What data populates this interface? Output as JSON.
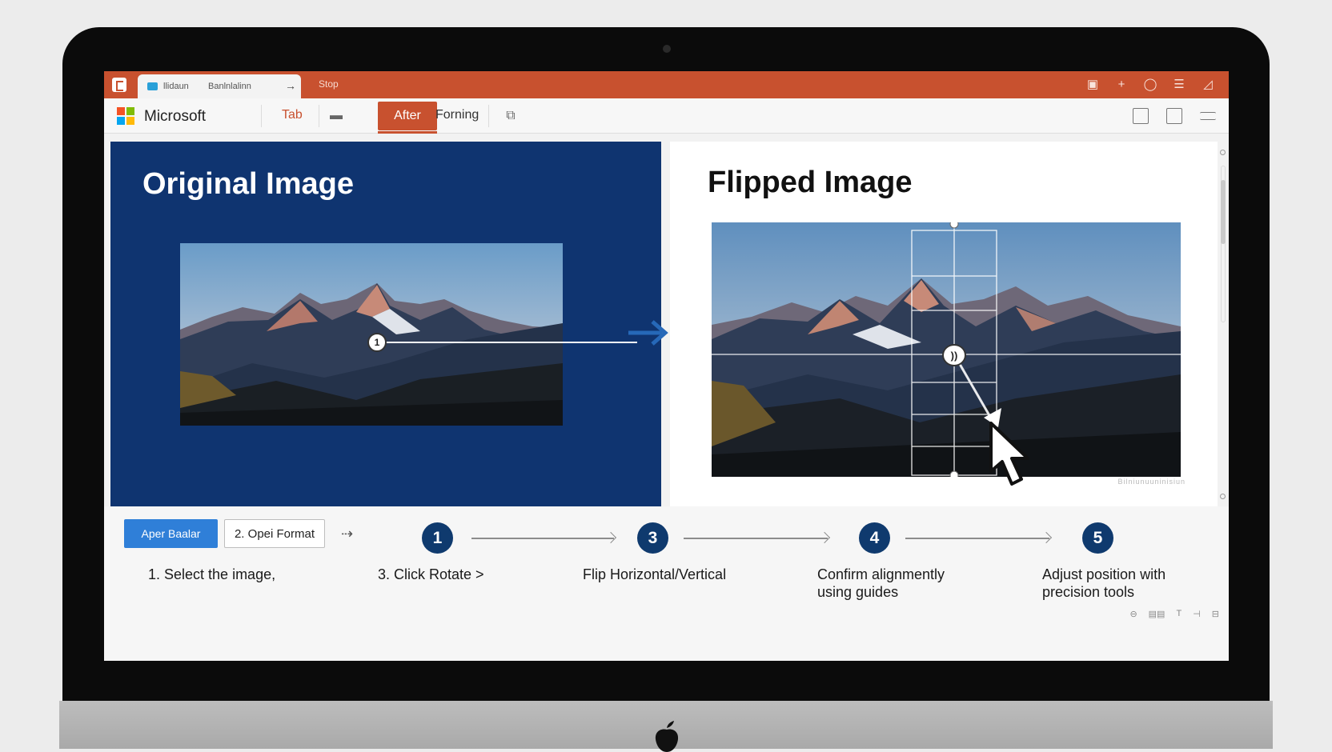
{
  "window": {
    "tab_text_1": "llidaun",
    "tab_text_2": "Banlnlalinn",
    "tab_arrow": "→",
    "title_text": "Stop"
  },
  "ribbon": {
    "brand": "Microsoft",
    "tabs": [
      {
        "label": "Tab"
      },
      {
        "label": "After"
      },
      {
        "label": "Forning"
      }
    ]
  },
  "panels": {
    "left_title": "Original Image",
    "right_title": "Flipped Image",
    "left_marker": "1",
    "right_marker": "))",
    "watermark": "Bilniunuuninisiun"
  },
  "actions": {
    "primary_label": "Aper Baalar",
    "secondary_label": "2. Opei Format"
  },
  "steps": [
    {
      "number": "1",
      "label": "1. Select the image,"
    },
    {
      "number": "3",
      "label": "3. Click Rotate >"
    },
    {
      "number": "4",
      "label": "Flip Horizontal/Vertical"
    },
    {
      "number": "5",
      "label": "Confirm alignmently\nusing guides"
    },
    {
      "label": "Adjust position with\nprecision tools"
    }
  ],
  "colors": {
    "accent_orange": "#c8512f",
    "panel_blue": "#0f3470",
    "step_navy": "#0f3a6e",
    "button_blue": "#2f7fd8",
    "arrow_blue": "#2668b8"
  },
  "icons": [
    "app-icon",
    "microsoft-logo-icon",
    "layout-icon",
    "image-icon",
    "share-icon",
    "cursor-icon",
    "apple-logo-icon"
  ]
}
